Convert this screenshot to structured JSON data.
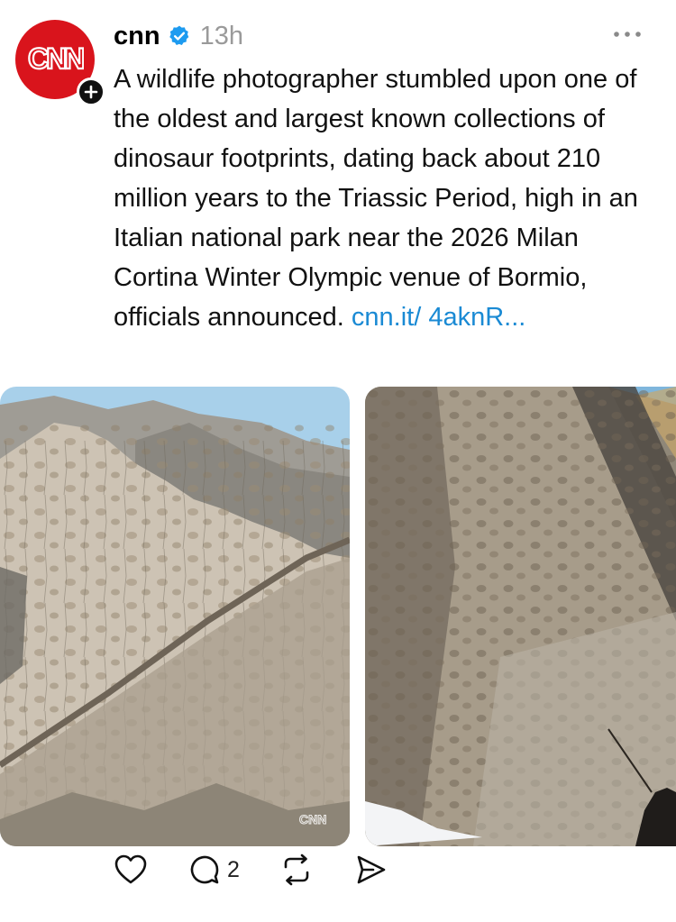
{
  "post": {
    "username": "cnn",
    "timestamp": "13h",
    "body_text": "A wildlife photographer stumbled upon one of the oldest and largest known collections of dinosaur footprints, dating back about 210 million years to the Triassic Period, high in an Italian national park near the 2026 Milan Cortina Winter Olympic venue of Bormio, officials announced.",
    "link_text": "cnn.it/ 4aknR...",
    "avatar_logo": "CNN",
    "image_watermark": "CNN"
  },
  "actions": {
    "replies_count": "2"
  },
  "icons": {
    "more": "more-options-icon",
    "verified": "verified-badge-icon",
    "follow": "plus-icon",
    "like": "heart-icon",
    "reply": "comment-icon",
    "repost": "repost-icon",
    "share": "send-icon"
  },
  "colors": {
    "brand_red": "#d9141c",
    "link_blue": "#1a8ad4",
    "verified_blue": "#1d9bf0",
    "muted_gray": "#9a9a9a"
  }
}
